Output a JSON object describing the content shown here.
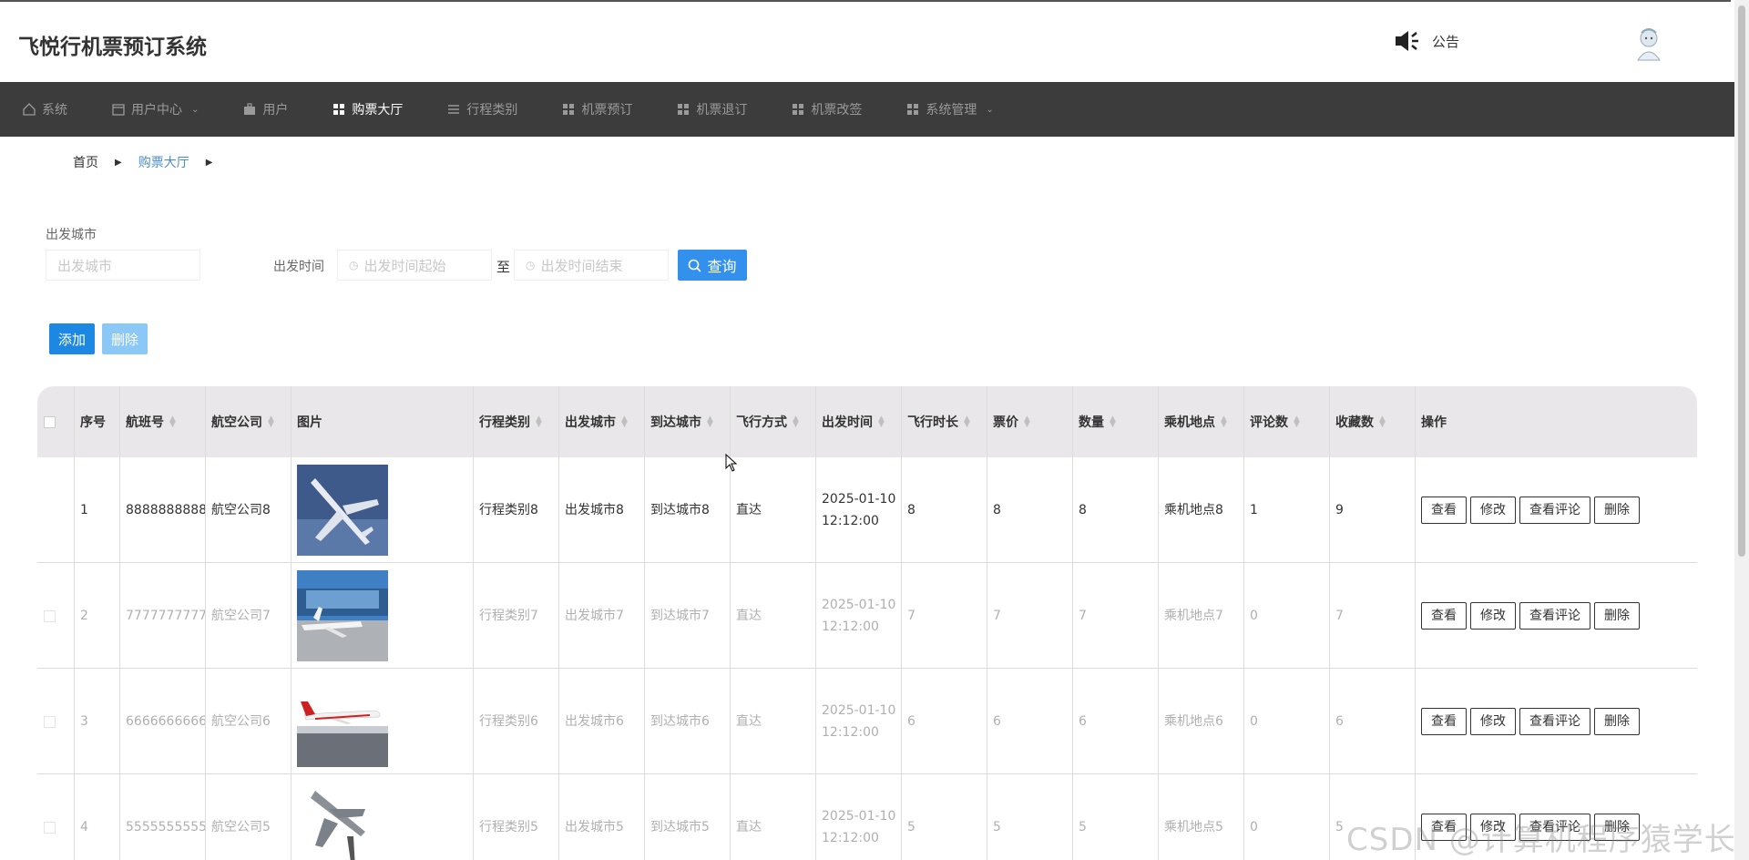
{
  "header": {
    "app_title": "飞悦行机票预订系统",
    "notice_label": "公告"
  },
  "nav": [
    {
      "label": "系统",
      "icon": "home-icon"
    },
    {
      "label": "用户中心",
      "icon": "calendar-icon",
      "dropdown": true
    },
    {
      "label": "用户",
      "icon": "briefcase-icon"
    },
    {
      "label": "购票大厅",
      "icon": "grid-icon",
      "active": true
    },
    {
      "label": "行程类别",
      "icon": "list-icon"
    },
    {
      "label": "机票预订",
      "icon": "grid-icon"
    },
    {
      "label": "机票退订",
      "icon": "grid-icon"
    },
    {
      "label": "机票改签",
      "icon": "grid-icon"
    },
    {
      "label": "系统管理",
      "icon": "grid-icon",
      "dropdown": true
    }
  ],
  "breadcrumb": {
    "home": "首页",
    "current": "购票大厅"
  },
  "search": {
    "city_label": "出发城市",
    "city_placeholder": "出发城市",
    "time_label": "出发时间",
    "time_start_placeholder": "出发时间起始",
    "time_sep": "至",
    "time_end_placeholder": "出发时间结束",
    "query_label": "查询"
  },
  "actions": {
    "add_label": "添加",
    "delete_label": "删除"
  },
  "table": {
    "headers": {
      "index": "序号",
      "flight_no": "航班号",
      "airline": "航空公司",
      "image": "图片",
      "trip_type": "行程类别",
      "from_city": "出发城市",
      "to_city": "到达城市",
      "mode": "飞行方式",
      "depart_time": "出发时间",
      "duration": "飞行时长",
      "price": "票价",
      "quantity": "数量",
      "boarding": "乘机地点",
      "comments": "评论数",
      "favorites": "收藏数",
      "ops": "操作"
    },
    "rows": [
      {
        "index": "1",
        "flight_no": "8888888888",
        "airline": "航空公司8",
        "image": "plane-topdown-image",
        "trip_type": "行程类别8",
        "from_city": "出发城市8",
        "to_city": "到达城市8",
        "mode": "直达",
        "date": "2025-01-10",
        "time": "12:12:00",
        "duration": "8",
        "price": "8",
        "quantity": "8",
        "boarding": "乘机地点8",
        "comments": "1",
        "favorites": "9"
      },
      {
        "index": "2",
        "flight_no": "7777777777",
        "airline": "航空公司7",
        "image": "airport-plane-image",
        "trip_type": "行程类别7",
        "from_city": "出发城市7",
        "to_city": "到达城市7",
        "mode": "直达",
        "date": "2025-01-10",
        "time": "12:12:00",
        "duration": "7",
        "price": "7",
        "quantity": "7",
        "boarding": "乘机地点7",
        "comments": "0",
        "favorites": "7"
      },
      {
        "index": "3",
        "flight_no": "6666666666",
        "airline": "航空公司6",
        "image": "red-tail-plane-image",
        "trip_type": "行程类别6",
        "from_city": "出发城市6",
        "to_city": "到达城市6",
        "mode": "直达",
        "date": "2025-01-10",
        "time": "12:12:00",
        "duration": "6",
        "price": "6",
        "quantity": "6",
        "boarding": "乘机地点6",
        "comments": "0",
        "favorites": "6"
      },
      {
        "index": "4",
        "flight_no": "5555555555",
        "airline": "航空公司5",
        "image": "fighter-jet-image",
        "trip_type": "行程类别5",
        "from_city": "出发城市5",
        "to_city": "到达城市5",
        "mode": "直达",
        "date": "2025-01-10",
        "time": "12:12:00",
        "duration": "5",
        "price": "5",
        "quantity": "5",
        "boarding": "乘机地点5",
        "comments": "0",
        "favorites": "5"
      }
    ],
    "row_ops": {
      "view": "查看",
      "edit": "修改",
      "view_comments": "查看评论",
      "delete": "删除"
    }
  },
  "watermark": "CSDN @计算机程序猿学长",
  "colors": {
    "nav_bg": "#3c3c3c",
    "primary": "#1c88e3",
    "query": "#3391ed",
    "disabled_delete": "#8cc8f5",
    "breadcrumb_active": "#4c8cc6"
  }
}
